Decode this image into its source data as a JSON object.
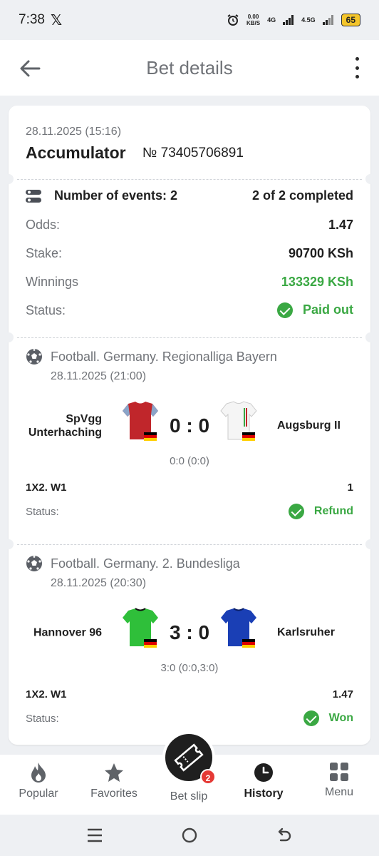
{
  "status_bar": {
    "time": "7:38",
    "x_logo": "𝕏",
    "net_speed": "0.00",
    "net_unit": "KB/S",
    "sig1": "4G",
    "sig2": "4.5G",
    "battery": "65"
  },
  "header": {
    "title": "Bet details"
  },
  "bet": {
    "datetime": "28.11.2025 (15:16)",
    "type": "Accumulator",
    "number": "№ 73405706891",
    "events_label": "Number of events: 2",
    "completed": "2 of 2 completed",
    "odds_label": "Odds:",
    "odds": "1.47",
    "stake_label": "Stake:",
    "stake": "90700 KSh",
    "winnings_label": "Winnings",
    "winnings": "133329 KSh",
    "status_label": "Status:",
    "status": "Paid out"
  },
  "events": [
    {
      "league": "Football. Germany. Regionalliga Bayern",
      "date": "28.11.2025 (21:00)",
      "home_line1": "SpVgg",
      "home_line2": "Unterhaching",
      "away": "Augsburg II",
      "score": "0 : 0",
      "periods": "0:0 (0:0)",
      "market": "1X2. W1",
      "coef": "1",
      "status_label": "Status:",
      "status": "Refund"
    },
    {
      "league": "Football. Germany. 2. Bundesliga",
      "date": "28.11.2025 (20:30)",
      "home": "Hannover 96",
      "away": "Karlsruher",
      "score": "3 : 0",
      "periods": "3:0 (0:0,3:0)",
      "market": "1X2. W1",
      "coef": "1.47",
      "status_label": "Status:",
      "status": "Won"
    }
  ],
  "nav": {
    "popular": "Popular",
    "favorites": "Favorites",
    "betslip": "Bet slip",
    "betslip_count": "2",
    "history": "History",
    "menu": "Menu"
  },
  "colors": {
    "accent_green": "#3aa843",
    "badge_red": "#e53935",
    "text_gray": "#707378"
  }
}
